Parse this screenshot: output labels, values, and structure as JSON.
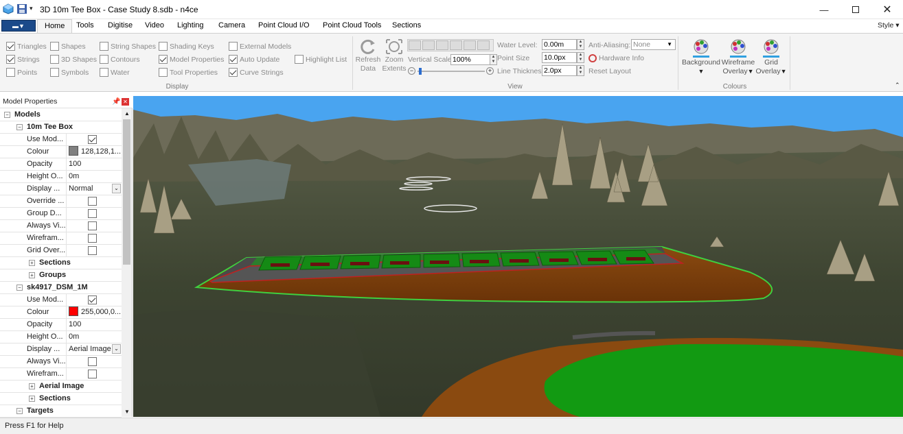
{
  "window": {
    "title": "3D 10m Tee Box - Case Study 8.sdb - n4ce"
  },
  "tabs": [
    "Home",
    "Tools",
    "Digitise",
    "Video",
    "Lighting",
    "Camera",
    "Point Cloud I/O",
    "Point Cloud Tools",
    "Sections"
  ],
  "style_menu": "Style",
  "display_group": {
    "label": "Display",
    "col1": [
      {
        "label": "Triangles",
        "checked": true
      },
      {
        "label": "Strings",
        "checked": true
      },
      {
        "label": "Points",
        "checked": false
      }
    ],
    "col2": [
      {
        "label": "Shapes",
        "checked": false
      },
      {
        "label": "3D Shapes",
        "checked": false
      },
      {
        "label": "Symbols",
        "checked": false
      }
    ],
    "col3": [
      {
        "label": "String Shapes",
        "checked": false
      },
      {
        "label": "Contours",
        "checked": false
      },
      {
        "label": "Water",
        "checked": false
      }
    ],
    "col4": [
      {
        "label": "Shading Keys",
        "checked": false
      },
      {
        "label": "Model Properties",
        "checked": true
      },
      {
        "label": "Tool Properties",
        "checked": false
      }
    ],
    "col5": [
      {
        "label": "External Models",
        "checked": false
      },
      {
        "label": "Auto Update",
        "checked": true
      },
      {
        "label": "Curve Strings",
        "checked": true
      }
    ],
    "col6": [
      {
        "label": "Highlight List",
        "checked": false
      }
    ]
  },
  "view_group": {
    "label": "View",
    "refresh": "Refresh Data",
    "refresh_l1": "Refresh",
    "refresh_l2": "Data",
    "zoom_l1": "Zoom",
    "zoom_l2": "Extents",
    "vertical_scale_label": "Vertical Scale:",
    "vertical_scale_value": "100%",
    "water_level_label": "Water Level:",
    "water_level_value": "0.00m",
    "point_size_label": "Point Size",
    "point_size_value": "10.0px",
    "line_thickness_label": "Line Thickness",
    "line_thickness_value": "2.0px",
    "anti_aliasing_label": "Anti-Aliasing:",
    "anti_aliasing_value": "None",
    "hardware_info": "Hardware Info",
    "reset_layout": "Reset Layout"
  },
  "colours_group": {
    "label": "Colours",
    "background": "Background",
    "wireframe_l1": "Wireframe",
    "wireframe_l2": "Overlay",
    "grid_l1": "Grid",
    "grid_l2": "Overlay"
  },
  "panel": {
    "title": "Model Properties",
    "rows": [
      {
        "type": "cat",
        "indent": 0,
        "label": "Models",
        "sign": "−"
      },
      {
        "type": "cat",
        "indent": 1,
        "label": "10m Tee Box",
        "sign": "−"
      },
      {
        "type": "prop",
        "k": "Use Mod...",
        "check": true
      },
      {
        "type": "prop",
        "k": "Colour",
        "swatch": "#808080",
        "v": "128,128,1..."
      },
      {
        "type": "prop",
        "k": "Opacity",
        "v": "100"
      },
      {
        "type": "prop",
        "k": "Height O...",
        "v": "0m"
      },
      {
        "type": "prop",
        "k": "Display ...",
        "v": "Normal",
        "dropdown": true
      },
      {
        "type": "prop",
        "k": "Override ...",
        "check": false
      },
      {
        "type": "prop",
        "k": "Group D...",
        "check": false
      },
      {
        "type": "prop",
        "k": "Always Vi...",
        "check": false
      },
      {
        "type": "prop",
        "k": "Wirefram...",
        "check": false
      },
      {
        "type": "prop",
        "k": "Grid Over...",
        "check": false
      },
      {
        "type": "cat",
        "indent": 2,
        "label": "Sections",
        "sign": "+"
      },
      {
        "type": "cat",
        "indent": 2,
        "label": "Groups",
        "sign": "+"
      },
      {
        "type": "cat",
        "indent": 1,
        "label": "sk4917_DSM_1M",
        "sign": "−"
      },
      {
        "type": "prop",
        "k": "Use Mod...",
        "check": true
      },
      {
        "type": "prop",
        "k": "Colour",
        "swatch": "#ff0000",
        "v": "255,000,0..."
      },
      {
        "type": "prop",
        "k": "Opacity",
        "v": "100"
      },
      {
        "type": "prop",
        "k": "Height O...",
        "v": "0m"
      },
      {
        "type": "prop",
        "k": "Display ...",
        "v": "Aerial Image",
        "dropdown": true
      },
      {
        "type": "prop",
        "k": "Always Vi...",
        "check": false
      },
      {
        "type": "prop",
        "k": "Wirefram...",
        "check": false
      },
      {
        "type": "cat",
        "indent": 2,
        "label": "Aerial Image",
        "sign": "+"
      },
      {
        "type": "cat",
        "indent": 2,
        "label": "Sections",
        "sign": "+"
      },
      {
        "type": "cat",
        "indent": 1,
        "label": "Targets",
        "sign": "−"
      }
    ]
  },
  "status": "Press F1 for Help",
  "colors": {
    "sky": "#49a4f0",
    "ground": "#3f4633",
    "accent": "#1b4a8a"
  }
}
